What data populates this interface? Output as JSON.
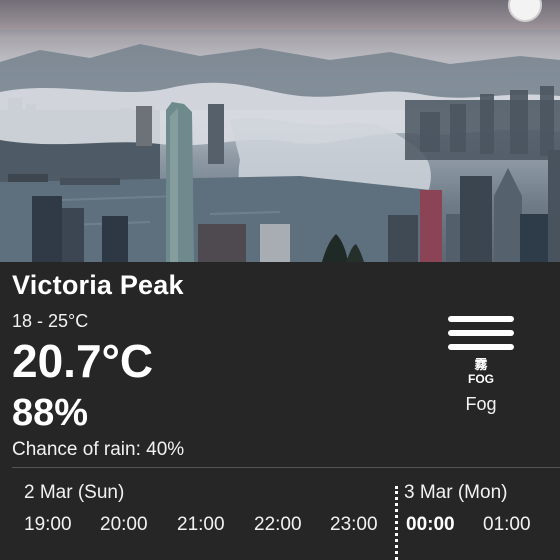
{
  "station": {
    "name": "Victoria Peak",
    "temp_range": "18 - 25°C",
    "temperature": "20.7°C",
    "humidity": "88%",
    "rain_chance": "Chance of rain: 40%"
  },
  "weather": {
    "icon": "fog-icon",
    "icon_text_cn": "霧",
    "icon_text_en": "FOG",
    "label": "Fog"
  },
  "forecast": {
    "days": [
      {
        "label": "2 Mar (Sun)",
        "hours": [
          "19:00",
          "20:00",
          "21:00",
          "22:00",
          "23:00"
        ]
      },
      {
        "label": "3 Mar (Mon)",
        "hours": [
          "00:00",
          "01:00"
        ]
      }
    ]
  },
  "colors": {
    "panel_background": "#262626",
    "text": "#ffffff"
  }
}
